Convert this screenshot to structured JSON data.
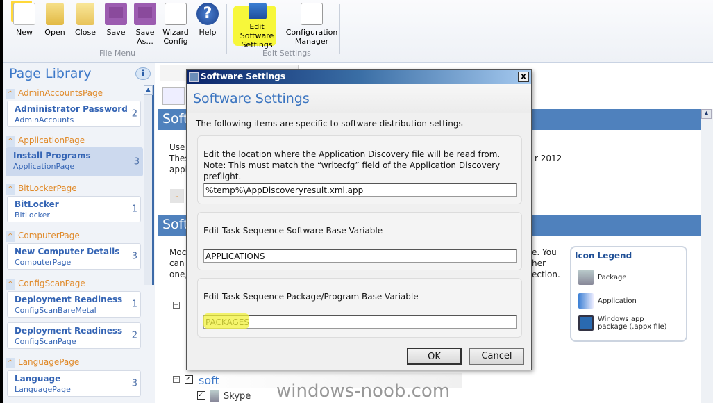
{
  "toolbar": {
    "file_buttons": [
      {
        "label": "New",
        "icon": "new-file-icon"
      },
      {
        "label": "Open",
        "icon": "open-folder-icon"
      },
      {
        "label": "Close",
        "icon": "close-folder-icon"
      },
      {
        "label": "Save",
        "icon": "save-icon"
      },
      {
        "label": "Save As...",
        "icon": "save-as-icon"
      },
      {
        "label": "Wizard Config",
        "icon": "wizard-config-icon"
      },
      {
        "label": "Help",
        "icon": "help-icon"
      }
    ],
    "file_group": "File Menu",
    "settings_buttons": [
      {
        "label": "Edit Software Settings",
        "icon": "software-settings-icon"
      },
      {
        "label": "Configuration Manager",
        "icon": "configuration-manager-icon"
      }
    ],
    "settings_group": "Edit Settings",
    "highlight_color": "#f7f73a"
  },
  "page_library": {
    "title": "Page Library",
    "groups": [
      {
        "name": "AdminAccountsPage",
        "items": [
          {
            "title": "Administrator Password",
            "sub": "AdminAccounts",
            "count": "2"
          }
        ]
      },
      {
        "name": "ApplicationPage",
        "items": [
          {
            "title": "Install Programs",
            "sub": "ApplicationPage",
            "count": "3",
            "selected": true
          }
        ]
      },
      {
        "name": "BitLockerPage",
        "items": [
          {
            "title": "BitLocker",
            "sub": "BitLocker",
            "count": "1"
          }
        ]
      },
      {
        "name": "ComputerPage",
        "items": [
          {
            "title": "New Computer Details",
            "sub": "ComputerPage",
            "count": "3"
          }
        ]
      },
      {
        "name": "ConfigScanPage",
        "items": [
          {
            "title": "Deployment Readiness",
            "sub": "ConfigScanBareMetal",
            "count": "1"
          },
          {
            "title": "Deployment Readiness",
            "sub": "ConfigScanPage",
            "count": "2"
          }
        ]
      },
      {
        "name": "LanguagePage",
        "items": [
          {
            "title": "Language",
            "sub": "LanguagePage",
            "count": "3"
          }
        ]
      }
    ]
  },
  "main": {
    "band1": "Soft",
    "band2": "Soft",
    "text1": [
      "Use",
      "Thes",
      "appl"
    ],
    "text1_right": "r 2012",
    "text2": [
      "Moc",
      "can a",
      "one,"
    ],
    "text2_right": [
      "e. You",
      "her",
      "ection."
    ],
    "legend": {
      "title": "Icon Legend",
      "items": [
        {
          "label": "Package",
          "icon": "package-icon"
        },
        {
          "label": "Application",
          "icon": "application-icon"
        },
        {
          "label": "Windows app package (.appx file)",
          "icon": "appx-package-icon"
        }
      ]
    },
    "tree": {
      "group": "soft",
      "child": "Skype"
    },
    "accent": "#4f81bd"
  },
  "watermark": "windows-noob.com",
  "dialog": {
    "window_title": "Software Settings",
    "heading": "Software Settings",
    "description": "The following items are specific to software distribution settings",
    "fields": [
      {
        "label": "Edit the location where the Application Discovery file will be read from. Note: This must match the “writecfg” field of the Application Discovery preflight.",
        "value": "%temp%\\AppDiscoveryresult.xml.app"
      },
      {
        "label": "Edit Task Sequence Software Base Variable",
        "value": "APPLICATIONS"
      },
      {
        "label": "Edit Task Sequence Package/Program Base Variable",
        "value": "PACKAGES"
      }
    ],
    "ok": "OK",
    "cancel": "Cancel",
    "close": "X"
  }
}
